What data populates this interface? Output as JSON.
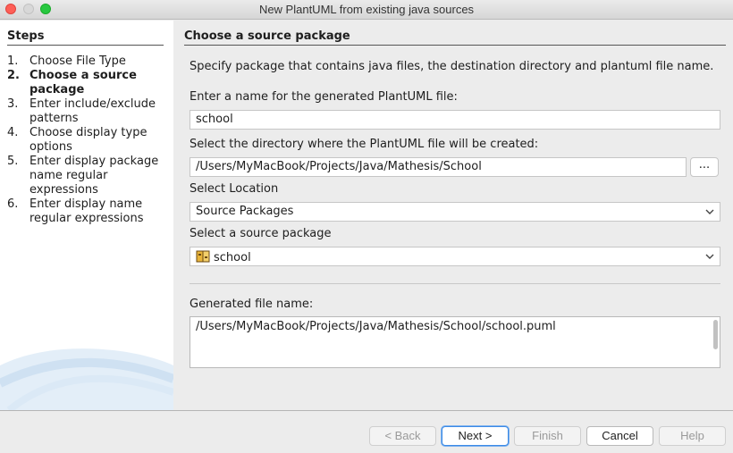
{
  "window": {
    "title": "New PlantUML from existing java sources"
  },
  "steps": {
    "title": "Steps",
    "items": [
      {
        "num": "1.",
        "label": "Choose File Type",
        "current": false
      },
      {
        "num": "2.",
        "label": "Choose a source package",
        "current": true
      },
      {
        "num": "3.",
        "label": "Enter include/exclude patterns",
        "current": false
      },
      {
        "num": "4.",
        "label": "Choose display type options",
        "current": false
      },
      {
        "num": "5.",
        "label": "Enter display package name regular expressions",
        "current": false
      },
      {
        "num": "6.",
        "label": "Enter display name regular expressions",
        "current": false
      }
    ]
  },
  "panel": {
    "title": "Choose a source package",
    "description": "Specify package that contains java files, the destination directory and plantuml file name.",
    "name_label": "Enter a name for the generated PlantUML file:",
    "name_value": "school",
    "dir_label": "Select the directory where the PlantUML file will be created:",
    "dir_value": "/Users/MyMacBook/Projects/Java/Mathesis/School",
    "browse_label": "...",
    "location_label": "Select Location",
    "location_value": "Source Packages",
    "package_label": "Select a source package",
    "package_value": "school",
    "package_icon": "package-icon",
    "generated_label": "Generated file name:",
    "generated_value": "/Users/MyMacBook/Projects/Java/Mathesis/School/school.puml"
  },
  "buttons": {
    "back": "< Back",
    "next": "Next >",
    "finish": "Finish",
    "cancel": "Cancel",
    "help": "Help"
  },
  "colors": {
    "accent": "#3c8be6",
    "close": "#fe5f57",
    "maximize": "#28c840"
  }
}
